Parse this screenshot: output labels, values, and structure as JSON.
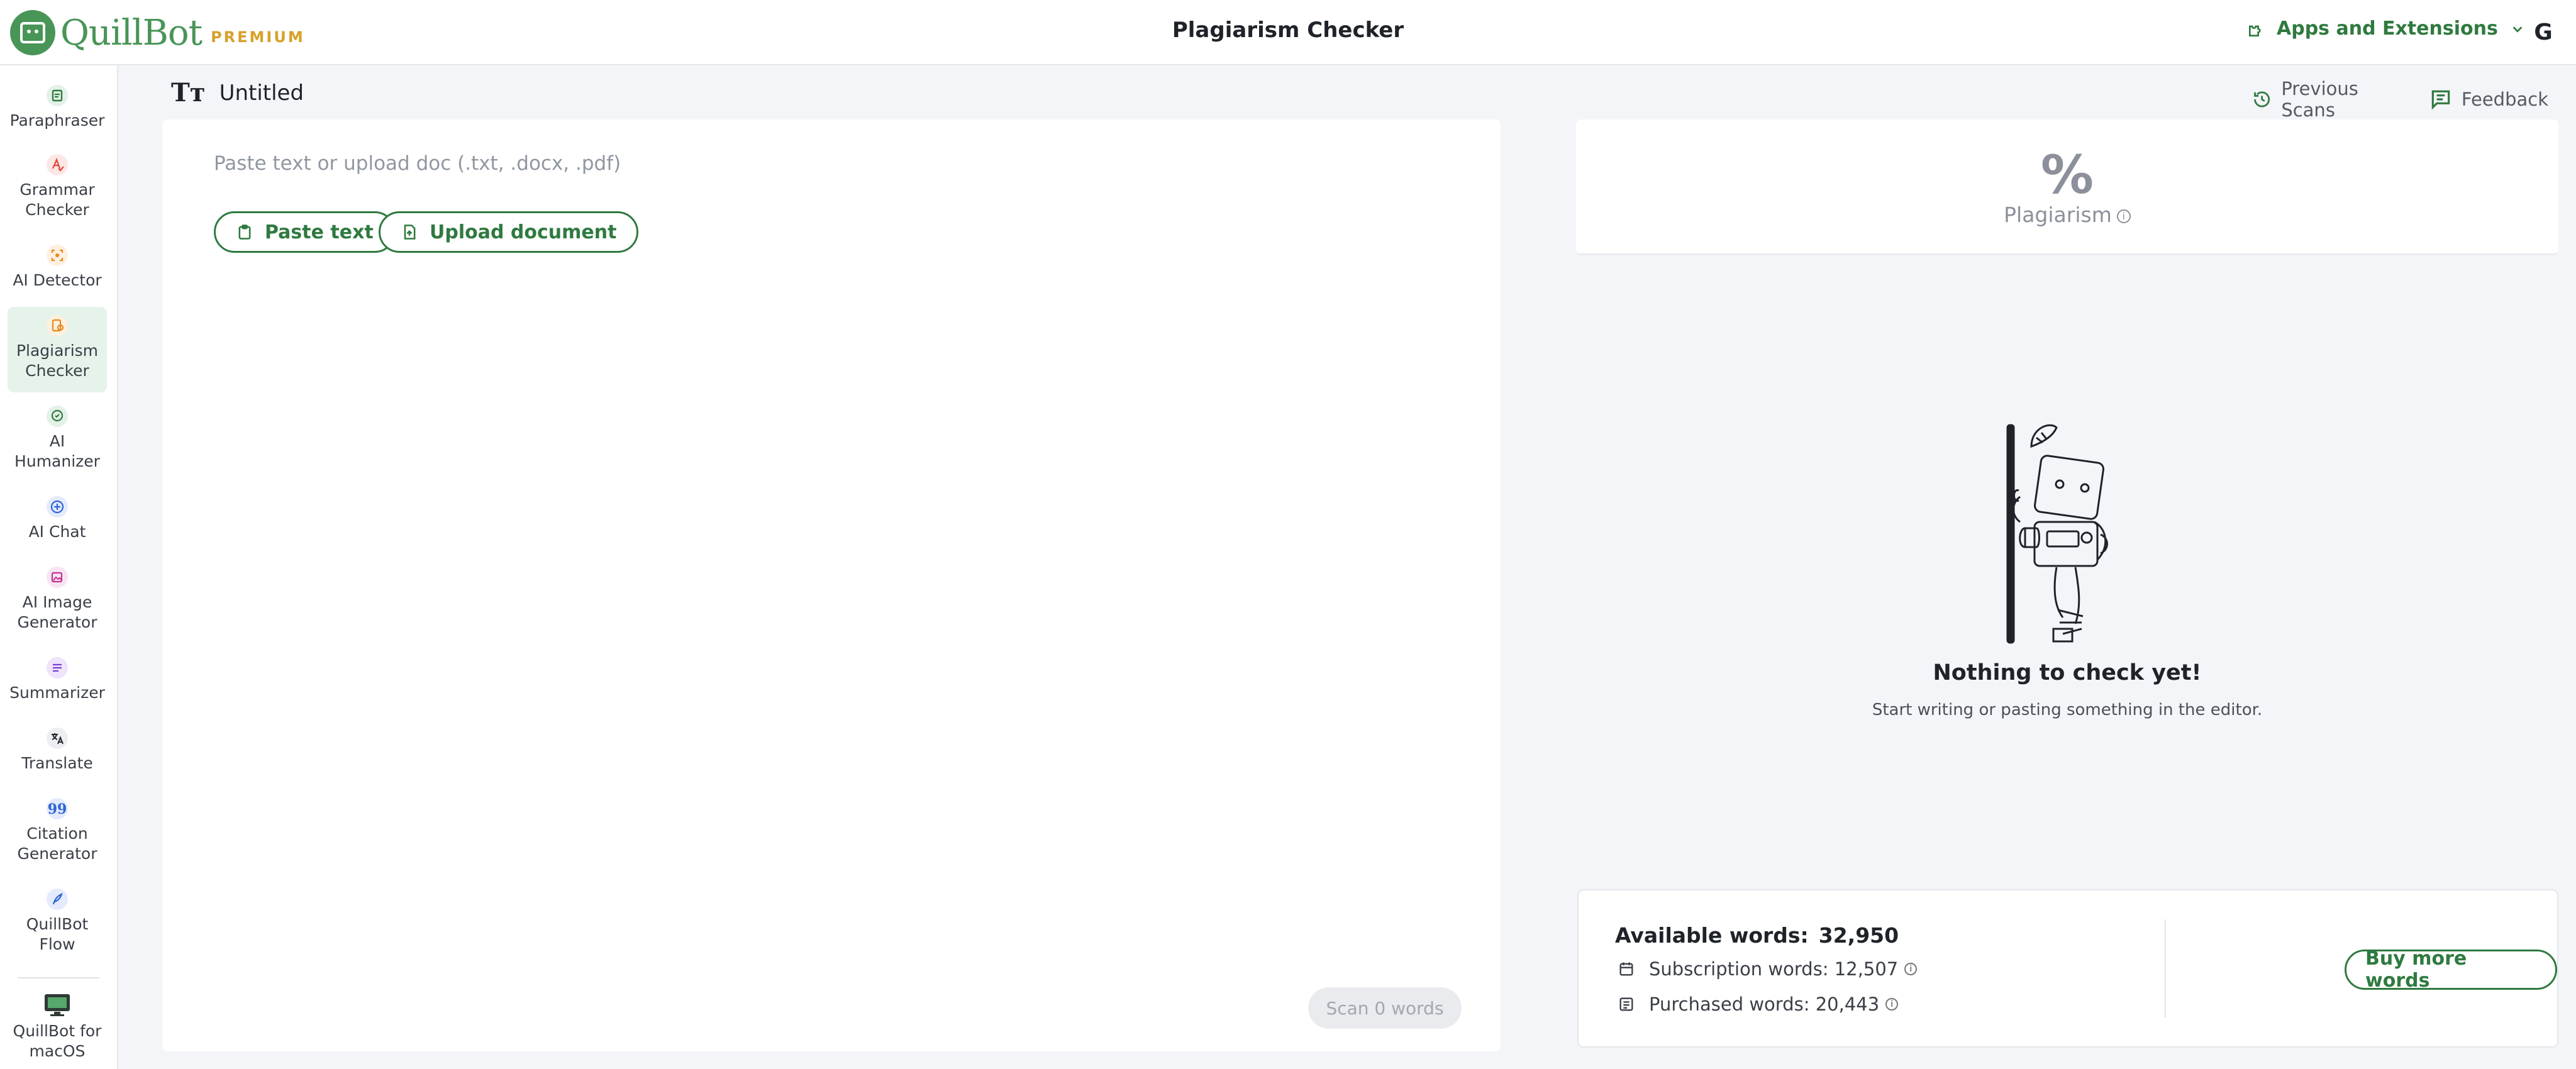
{
  "header": {
    "logo_text": "QuillBot",
    "logo_badge": "PREMIUM",
    "title": "Plagiarism Checker",
    "apps_label": "Apps and Extensions",
    "avatar_initial": "G"
  },
  "sidebar": {
    "items": [
      {
        "label": "Paraphraser",
        "icon": "paraphraser-icon"
      },
      {
        "label": "Grammar Checker",
        "icon": "grammar-checker-icon"
      },
      {
        "label": "AI Detector",
        "icon": "ai-detector-icon"
      },
      {
        "label": "Plagiarism Checker",
        "icon": "plagiarism-checker-icon",
        "active": true
      },
      {
        "label": "AI Humanizer",
        "icon": "ai-humanizer-icon"
      },
      {
        "label": "AI Chat",
        "icon": "ai-chat-icon"
      },
      {
        "label": "AI Image Generator",
        "icon": "ai-image-generator-icon"
      },
      {
        "label": "Summarizer",
        "icon": "summarizer-icon"
      },
      {
        "label": "Translate",
        "icon": "translate-icon"
      },
      {
        "label": "Citation Generator",
        "icon": "citation-generator-icon"
      },
      {
        "label": "QuillBot Flow",
        "icon": "quillbot-flow-icon"
      },
      {
        "label": "QuillBot for macOS",
        "icon": "macos-icon"
      }
    ]
  },
  "document": {
    "title": "Untitled",
    "previous_scans": "Previous Scans",
    "feedback": "Feedback"
  },
  "editor": {
    "placeholder": "Paste text or upload doc (.txt, .docx, .pdf)",
    "paste_label": "Paste text",
    "upload_label": "Upload document",
    "scan_label": "Scan 0 words"
  },
  "results": {
    "percent_symbol": "%",
    "plagiarism_label": "Plagiarism",
    "empty_title": "Nothing to check yet!",
    "empty_subtitle": "Start writing or pasting something in the editor."
  },
  "words": {
    "available_label": "Available words:",
    "available_value": "32,950",
    "subscription_label": "Subscription words: 12,507",
    "purchased_label": "Purchased words: 20,443",
    "buy_label": "Buy more words"
  },
  "colors": {
    "brand_green": "#499557",
    "accent_green": "#2f7a3f",
    "premium_gold": "#d7a12a"
  }
}
